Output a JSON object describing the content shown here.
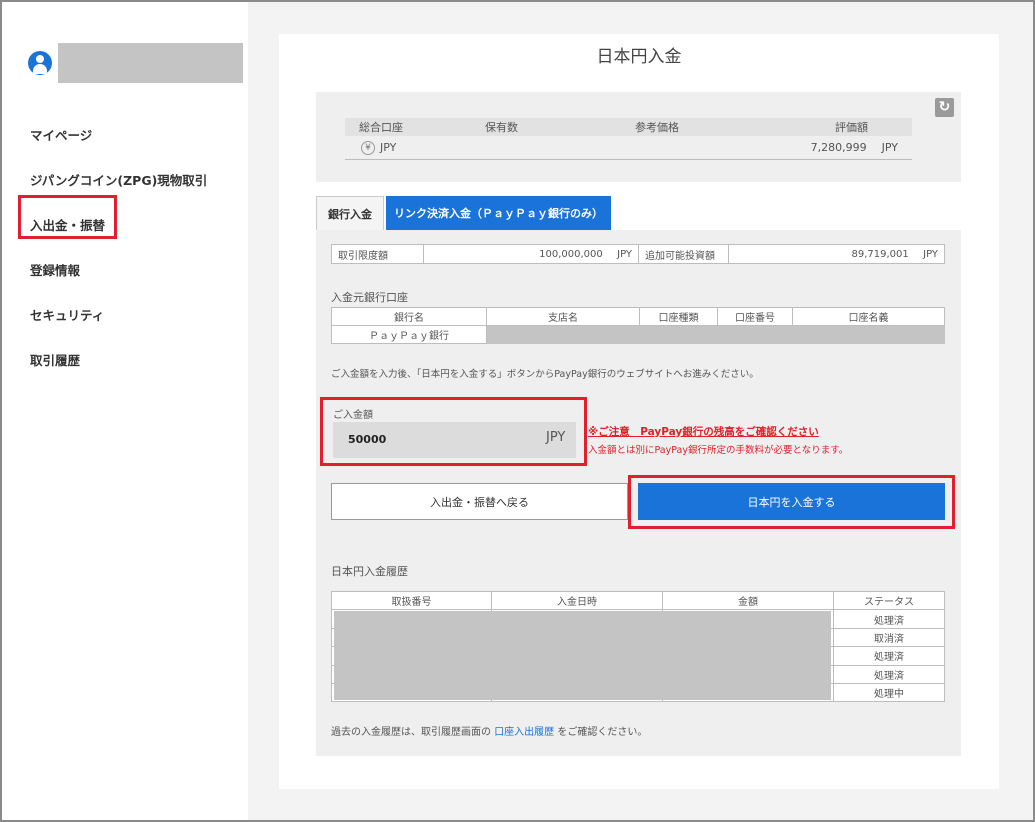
{
  "sidebar": {
    "items": [
      {
        "label": "マイページ"
      },
      {
        "label": "ジパングコイン(ZPG)現物取引"
      },
      {
        "label": "入出金・振替"
      },
      {
        "label": "登録情報"
      },
      {
        "label": "セキュリティ"
      },
      {
        "label": "取引履歴"
      }
    ]
  },
  "page": {
    "title": "日本円入金"
  },
  "summary": {
    "headers": [
      "総合口座",
      "保有数",
      "参考価格",
      "評価額"
    ],
    "row": {
      "currency_symbol": "¥",
      "currency": "JPY",
      "valuation": "7,280,999",
      "unit": "JPY"
    }
  },
  "tabs": [
    {
      "label": "銀行入金",
      "active": false
    },
    {
      "label": "リンク決済入金（ＰａｙＰａｙ銀行のみ）",
      "active": true
    }
  ],
  "limits": {
    "trade_limit_label": "取引限度額",
    "trade_limit_value": "100,000,000",
    "trade_limit_unit": "JPY",
    "additional_label": "追加可能投資額",
    "additional_value": "89,719,001",
    "additional_unit": "JPY"
  },
  "bank_account": {
    "section_label": "入金元銀行口座",
    "headers": [
      "銀行名",
      "支店名",
      "口座種類",
      "口座番号",
      "口座名義"
    ],
    "bank_name": "ＰａｙＰａｙ銀行"
  },
  "instruction": "ご入金額を入力後、「日本円を入金する」ボタンからPayPay銀行のウェブサイトへお進みください。",
  "amount": {
    "label": "ご入金額",
    "value": "50000",
    "unit": "JPY"
  },
  "warning": {
    "title": "※ご注意　PayPay銀行の残高をご確認ください",
    "detail": "入金額とは別にPayPay銀行所定の手数料が必要となります。"
  },
  "buttons": {
    "back": "入出金・振替へ戻る",
    "submit": "日本円を入金する"
  },
  "history": {
    "section_label": "日本円入金履歴",
    "headers": [
      "取扱番号",
      "入金日時",
      "金額",
      "ステータス"
    ],
    "statuses": [
      "処理済",
      "取消済",
      "処理済",
      "処理済",
      "処理中"
    ]
  },
  "footer": {
    "prefix": "過去の入金履歴は、取引履歴画面の",
    "link": "口座入出履歴",
    "suffix": "をご確認ください。"
  },
  "colors": {
    "accent": "#1a73d9",
    "highlight": "#e0202c"
  }
}
